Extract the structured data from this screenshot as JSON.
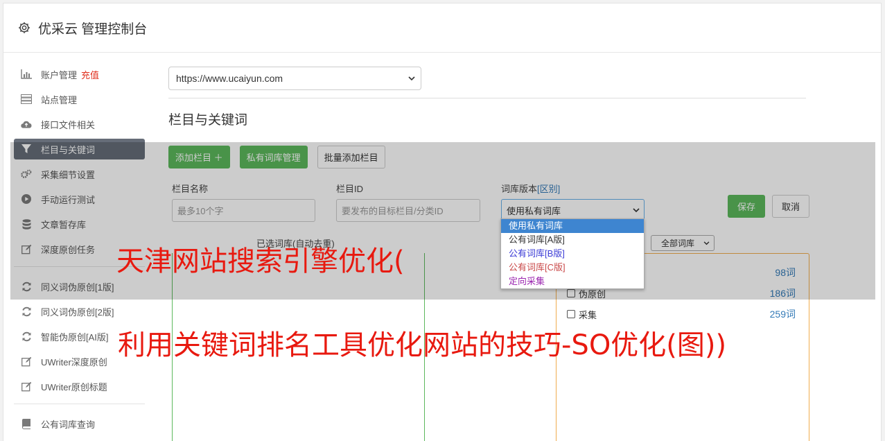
{
  "header": {
    "title": "优采云 管理控制台",
    "icon": "gear-icon"
  },
  "sidebar": {
    "items": [
      {
        "label": "账户管理",
        "badge": "充值",
        "icon": "bar-chart-icon"
      },
      {
        "label": "站点管理",
        "icon": "server-icon"
      },
      {
        "label": "接口文件相关",
        "icon": "cloud-upload-icon"
      },
      {
        "label": "栏目与关键词",
        "icon": "filter-icon",
        "active": true
      },
      {
        "label": "采集细节设置",
        "icon": "gears-icon"
      },
      {
        "label": "手动运行测试",
        "icon": "play-icon"
      },
      {
        "label": "文章暂存库",
        "icon": "database-icon"
      },
      {
        "label": "深度原创任务",
        "icon": "edit-icon"
      },
      {
        "label": "同义词伪原创[1版]",
        "icon": "refresh-icon"
      },
      {
        "label": "同义词伪原创[2版]",
        "icon": "refresh-icon"
      },
      {
        "label": "智能伪原创[AI版]",
        "icon": "refresh-icon"
      },
      {
        "label": "UWriter深度原创",
        "icon": "edit-icon"
      },
      {
        "label": "UWriter原创标题",
        "icon": "edit-icon"
      },
      {
        "label": "公有词库查询",
        "icon": "book-icon"
      }
    ]
  },
  "main": {
    "site_select": "https://www.ucaiyun.com",
    "section_title": "栏目与关键词",
    "toolbar": {
      "add_column": "添加栏目 ＋",
      "private_lib": "私有词库管理",
      "batch_add": "批量添加栏目"
    },
    "form": {
      "name_label": "栏目名称",
      "name_placeholder": "最多10个字",
      "id_label": "栏目ID",
      "id_placeholder": "要发布的目标栏目/分类ID",
      "lib_label": "词库版本",
      "lib_link": "[区别]",
      "lib_value": "使用私有词库",
      "save": "保存",
      "cancel": "取消"
    },
    "dropdown_options": [
      {
        "label": "使用私有词库",
        "color": "#ffffff"
      },
      {
        "label": "公有词库[A版]",
        "color": "#333333"
      },
      {
        "label": "公有词库[B版]",
        "color": "#3b3bd6"
      },
      {
        "label": "公有词库[C版]",
        "color": "#c94848"
      },
      {
        "label": "定向采集",
        "color": "#9b27b0"
      }
    ],
    "selected_label": "已选词库(自动去重)",
    "lib_filter": "全部词库",
    "libraries": [
      {
        "label": "",
        "count": "98词"
      },
      {
        "label": "伪原创",
        "count": "186词"
      },
      {
        "label": "采集",
        "count": "259词"
      }
    ]
  },
  "watermark": {
    "line1": "天津网站搜索引擎优化(",
    "line2": "利用关键词排名工具优化网站的技巧-SO优化(图))"
  }
}
